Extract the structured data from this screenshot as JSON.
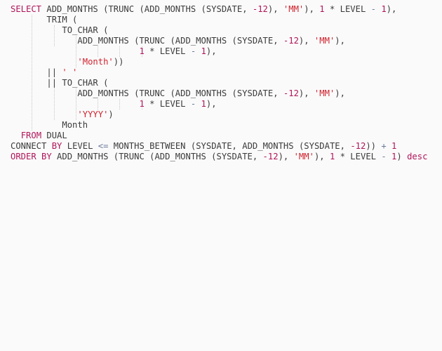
{
  "editor": {
    "language": "sql",
    "lines": [
      [
        {
          "t": "kw",
          "v": "SELECT"
        },
        {
          "t": "p",
          "v": " ADD_MONTHS (TRUNC (ADD_MONTHS (SYSDATE, "
        },
        {
          "t": "num",
          "v": "-12"
        },
        {
          "t": "p",
          "v": "), "
        },
        {
          "t": "str",
          "v": "'MM'"
        },
        {
          "t": "p",
          "v": "), "
        },
        {
          "t": "num",
          "v": "1"
        },
        {
          "t": "p",
          "v": " * LEVEL "
        },
        {
          "t": "op",
          "v": "-"
        },
        {
          "t": "p",
          "v": " "
        },
        {
          "t": "num",
          "v": "1"
        },
        {
          "t": "p",
          "v": "),"
        }
      ],
      [
        {
          "t": "p",
          "v": "       TRIM ("
        }
      ],
      [
        {
          "t": "p",
          "v": "          TO_CHAR ("
        }
      ],
      [
        {
          "t": "p",
          "v": "             ADD_MONTHS (TRUNC (ADD_MONTHS (SYSDATE, "
        },
        {
          "t": "num",
          "v": "-12"
        },
        {
          "t": "p",
          "v": "), "
        },
        {
          "t": "str",
          "v": "'MM'"
        },
        {
          "t": "p",
          "v": "),"
        }
      ],
      [
        {
          "t": "p",
          "v": "                         "
        },
        {
          "t": "num",
          "v": "1"
        },
        {
          "t": "p",
          "v": " * LEVEL "
        },
        {
          "t": "op",
          "v": "-"
        },
        {
          "t": "p",
          "v": " "
        },
        {
          "t": "num",
          "v": "1"
        },
        {
          "t": "p",
          "v": "),"
        }
      ],
      [
        {
          "t": "p",
          "v": "             "
        },
        {
          "t": "str",
          "v": "'Month'"
        },
        {
          "t": "p",
          "v": "))"
        }
      ],
      [
        {
          "t": "p",
          "v": "       || "
        },
        {
          "t": "str",
          "v": "' '"
        }
      ],
      [
        {
          "t": "p",
          "v": "       || TO_CHAR ("
        }
      ],
      [
        {
          "t": "p",
          "v": "             ADD_MONTHS (TRUNC (ADD_MONTHS (SYSDATE, "
        },
        {
          "t": "num",
          "v": "-12"
        },
        {
          "t": "p",
          "v": "), "
        },
        {
          "t": "str",
          "v": "'MM'"
        },
        {
          "t": "p",
          "v": "),"
        }
      ],
      [
        {
          "t": "p",
          "v": "                         "
        },
        {
          "t": "num",
          "v": "1"
        },
        {
          "t": "p",
          "v": " * LEVEL "
        },
        {
          "t": "op",
          "v": "-"
        },
        {
          "t": "p",
          "v": " "
        },
        {
          "t": "num",
          "v": "1"
        },
        {
          "t": "p",
          "v": "),"
        }
      ],
      [
        {
          "t": "p",
          "v": "             "
        },
        {
          "t": "str",
          "v": "'YYYY'"
        },
        {
          "t": "p",
          "v": ")"
        }
      ],
      [
        {
          "t": "p",
          "v": "          Month"
        }
      ],
      [
        {
          "t": "p",
          "v": "  "
        },
        {
          "t": "kw",
          "v": "FROM"
        },
        {
          "t": "p",
          "v": " DUAL"
        }
      ],
      [
        {
          "t": "p",
          "v": "CONNECT "
        },
        {
          "t": "kw",
          "v": "BY"
        },
        {
          "t": "p",
          "v": " LEVEL "
        },
        {
          "t": "op",
          "v": "<="
        },
        {
          "t": "p",
          "v": " MONTHS_BETWEEN (SYSDATE, ADD_MONTHS (SYSDATE, "
        },
        {
          "t": "num",
          "v": "-12"
        },
        {
          "t": "p",
          "v": ")) "
        },
        {
          "t": "op",
          "v": "+"
        },
        {
          "t": "p",
          "v": " "
        },
        {
          "t": "num",
          "v": "1"
        }
      ],
      [
        {
          "t": "kw",
          "v": "ORDER BY"
        },
        {
          "t": "p",
          "v": " ADD_MONTHS (TRUNC (ADD_MONTHS (SYSDATE, "
        },
        {
          "t": "num",
          "v": "-12"
        },
        {
          "t": "p",
          "v": "), "
        },
        {
          "t": "str",
          "v": "'MM'"
        },
        {
          "t": "p",
          "v": "), "
        },
        {
          "t": "num",
          "v": "1"
        },
        {
          "t": "p",
          "v": " * LEVEL "
        },
        {
          "t": "op",
          "v": "-"
        },
        {
          "t": "p",
          "v": " "
        },
        {
          "t": "num",
          "v": "1"
        },
        {
          "t": "p",
          "v": ") "
        },
        {
          "t": "kw",
          "v": "desc"
        }
      ]
    ]
  }
}
